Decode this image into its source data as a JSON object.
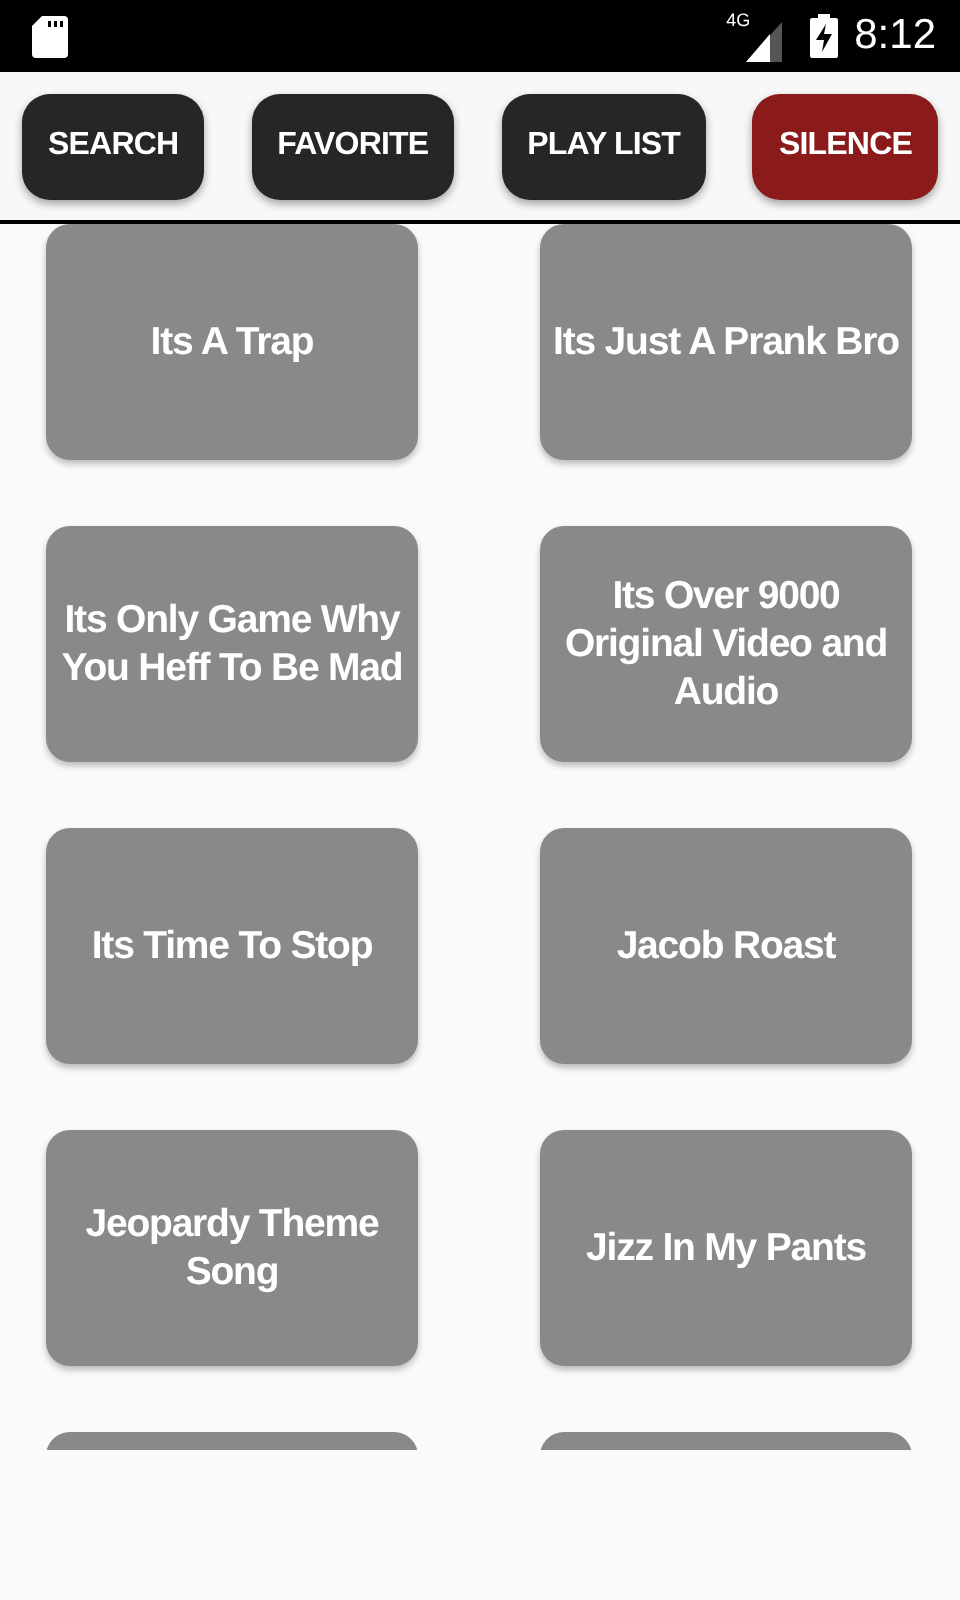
{
  "status_bar": {
    "time": "8:12",
    "network": "4G"
  },
  "toolbar": [
    {
      "label": "SEARCH",
      "color": "#262626"
    },
    {
      "label": "FAVORITE",
      "color": "#262626"
    },
    {
      "label": "PLAY LIST",
      "color": "#262626"
    },
    {
      "label": "SILENCE",
      "color": "#8b1a1a"
    }
  ],
  "tiles": [
    {
      "label": "Its A Trap",
      "partial": false
    },
    {
      "label": "Its Just A Prank Bro",
      "partial": false
    },
    {
      "label": "Its Only Game Why You Heff To Be Mad",
      "partial": false
    },
    {
      "label": "Its Over 9000 Original Video and Audio",
      "partial": false
    },
    {
      "label": "Its Time To Stop",
      "partial": false
    },
    {
      "label": "Jacob Roast",
      "partial": false
    },
    {
      "label": "Jeopardy Theme Song",
      "partial": false
    },
    {
      "label": "Jizz In My Pants",
      "partial": false
    },
    {
      "partial": true
    },
    {
      "partial": true
    }
  ]
}
